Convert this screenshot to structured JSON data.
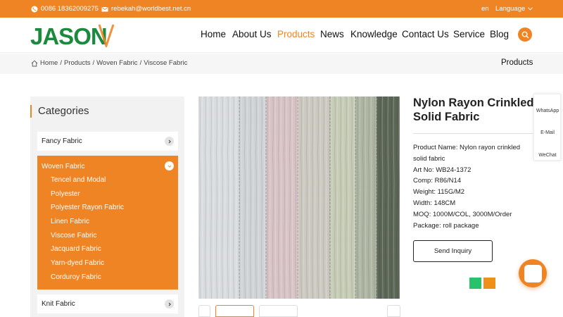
{
  "topbar": {
    "phone": "0086 18362009275",
    "email": "rebekah@worldbest.net.cn",
    "lang_code": "en",
    "language_label": "Language"
  },
  "header": {
    "logo_text": "JASON",
    "nav": [
      "Home",
      "About Us",
      "Products",
      "News",
      "Knowledge",
      "Contact Us",
      "Service",
      "Blog"
    ],
    "active_nav": "Products",
    "colors": {
      "accent": "#ef8425",
      "logo_green": "#1c8a3c"
    }
  },
  "breadcrumb": {
    "items": [
      "Home",
      "Products",
      "Woven Fabric",
      "Viscose Fabric"
    ],
    "separator": "/",
    "page_title": "Products"
  },
  "sidebar": {
    "title": "Categories",
    "fancy": "Fancy Fabric",
    "woven": "Woven Fabric",
    "woven_children": [
      "Tencel and Modal",
      "Polyester",
      "Polyester Rayon Fabric",
      "Linen Fabric",
      "Viscose Fabric",
      "Jacquard Fabric",
      "Yarn-dyed Fabric",
      "Corduroy Fabric"
    ],
    "knit": "Knit Fabric"
  },
  "product": {
    "title": "Nylon Rayon Crinkled Solid Fabric",
    "specs": [
      "Product Name: Nylon rayon crinkled solid fabric",
      "Art No: WB24-1372",
      "Comp: R86/N14",
      "Weight: 115G/M2",
      "Width: 148CM",
      "MOQ: 1000M/COL, 3000M/Order",
      "Package: roll package"
    ],
    "inquiry_label": "Send Inquiry"
  },
  "floatbar": {
    "items": [
      "WhatsApp",
      "E-Mail",
      "WeChat"
    ]
  },
  "icons": {
    "phone": "phone-icon",
    "mail": "mail-icon",
    "chevron": "chevron-down-icon",
    "search": "search-icon",
    "home": "home-icon",
    "chat": "chat-icon"
  }
}
